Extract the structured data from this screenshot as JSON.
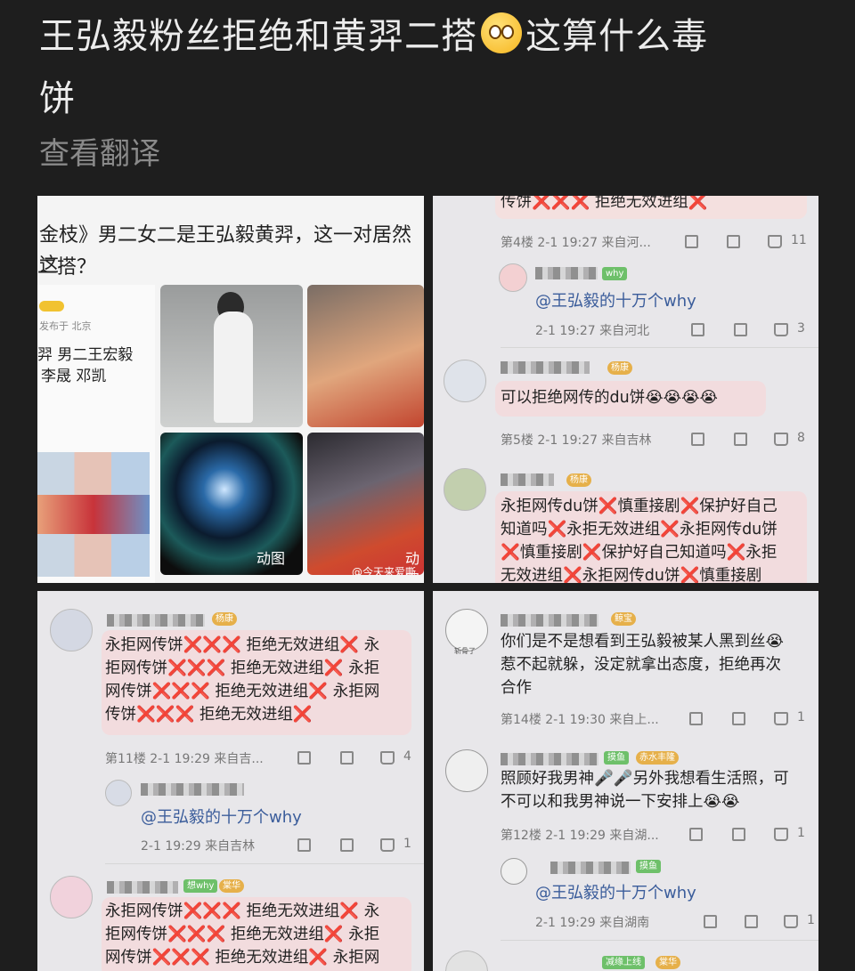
{
  "post": {
    "title_part1": "王弘毅粉丝拒绝和黄羿二搭",
    "title_part2": "这算什么毒",
    "title_part3": "饼",
    "translate_label": "查看翻译"
  },
  "news_card": {
    "headline_line1": "金枝》男二女二是王弘毅黄羿，这一对居然这",
    "headline_line2": "二搭？",
    "publish_label": "发布于 北京",
    "cast_line1": "羿 男二王宏毅",
    "cast_line2": "李晟 邓凯",
    "image_label_video": "动图",
    "image_label_video2": "动图",
    "watermark": "@今天来爱嘶"
  },
  "panel2": {
    "top_text": "传饼❌❌❌ 拒绝无效进组❌",
    "floor4_meta": "第4楼 2-1 19:27 来自河...",
    "floor4_likes": "11",
    "reply1_mention": "@王弘毅的十万个why",
    "reply1_meta": "2-1 19:27 来自河北",
    "reply1_likes": "3",
    "c5_badge": "杨康",
    "c5_text": "可以拒绝网传的du饼😭😭😭😭",
    "floor5_meta": "第5楼 2-1 19:27 来自吉林",
    "floor5_likes": "8",
    "c6_badge": "杨康",
    "c6_text_l1": "永拒网传du饼❌慎重接剧❌保护好自己",
    "c6_text_l2": "知道吗❌永拒无效进组❌永拒网传du饼",
    "c6_text_l3": "❌慎重接剧❌保护好自己知道吗❌永拒",
    "c6_text_l4": "无效进组❌永拒网传du饼❌慎重接剧",
    "badge_why": "why"
  },
  "panel3": {
    "c_badge": "杨康",
    "c_text_l1": "永拒网传饼❌❌❌ 拒绝无效进组❌ 永",
    "c_text_l2": "拒网传饼❌❌❌ 拒绝无效进组❌ 永拒",
    "c_text_l3": "网传饼❌❌❌ 拒绝无效进组❌ 永拒网",
    "c_text_l4": "传饼❌❌❌ 拒绝无效进组❌",
    "floor11_meta": "第11楼 2-1 19:29 来自吉...",
    "floor11_likes": "4",
    "reply_mention": "@王弘毅的十万个why",
    "reply_meta": "2-1 19:29 来自吉林",
    "reply_likes": "1",
    "c2_badge1": "想why",
    "c2_badge2": "棠华",
    "c2_text_l1": "永拒网传饼❌❌❌ 拒绝无效进组❌ 永",
    "c2_text_l2": "拒网传饼❌❌❌ 拒绝无效进组❌ 永拒",
    "c2_text_l3": "网传饼❌❌❌ 拒绝无效进组❌ 永拒网"
  },
  "panel4": {
    "c1_avatar_label": "斩骨了",
    "c1_badge": "鲸宝",
    "c1_text_l1": "你们是不是想看到王弘毅被某人黑到丝😭",
    "c1_text_l2": "惹不起就躲，没定就拿出态度，拒绝再次",
    "c1_text_l3": "合作",
    "floor14_meta": "第14楼 2-1 19:30 来自上...",
    "floor14_likes": "1",
    "c2_badge1": "摸鱼",
    "c2_badge2": "赤水丰隆",
    "c2_text_l1": "照顾好我男神🎤🎤另外我想看生活照，可",
    "c2_text_l2": "不可以和我男神说一下安排上😭😭",
    "floor12_meta": "第12楼 2-1 19:29 来自湖...",
    "floor12_likes": "1",
    "reply_badge": "摸鱼",
    "reply_mention": "@王弘毅的十万个why",
    "reply_meta": "2-1 19:29 来自湖南",
    "reply_likes": "1",
    "bottom_badge1": "减缘上线",
    "bottom_badge2": "棠华"
  }
}
